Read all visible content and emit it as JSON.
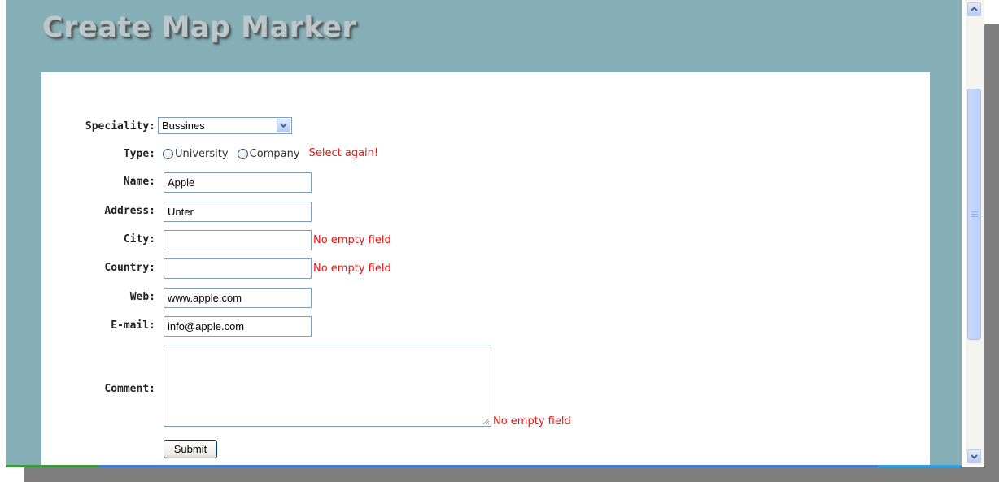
{
  "page": {
    "title": "Create Map Marker"
  },
  "form": {
    "speciality": {
      "label": "Speciality:",
      "selected": "Bussines"
    },
    "type": {
      "label": "Type:",
      "options": [
        "University",
        "Company"
      ],
      "error": "Select again!"
    },
    "name": {
      "label": "Name:",
      "value": "Apple"
    },
    "address": {
      "label": "Address:",
      "value": "Unter"
    },
    "city": {
      "label": "City:",
      "value": "",
      "error": "No empty field"
    },
    "country": {
      "label": "Country:",
      "value": "",
      "error": "No empty field"
    },
    "web": {
      "label": "Web:",
      "value": "www.apple.com"
    },
    "email": {
      "label": "E-mail:",
      "value": "info@apple.com"
    },
    "comment": {
      "label": "Comment:",
      "value": "",
      "error": "No empty field"
    },
    "submit_label": "Submit"
  },
  "colors": {
    "page_background": "#86aeb6",
    "error_text": "#e8120c",
    "input_border": "#7f9db9"
  },
  "icons": {
    "dropdown": "chevron-down-icon",
    "scroll_up": "arrow-up-icon",
    "scroll_down": "arrow-down-icon",
    "resize": "resize-grip-icon"
  }
}
